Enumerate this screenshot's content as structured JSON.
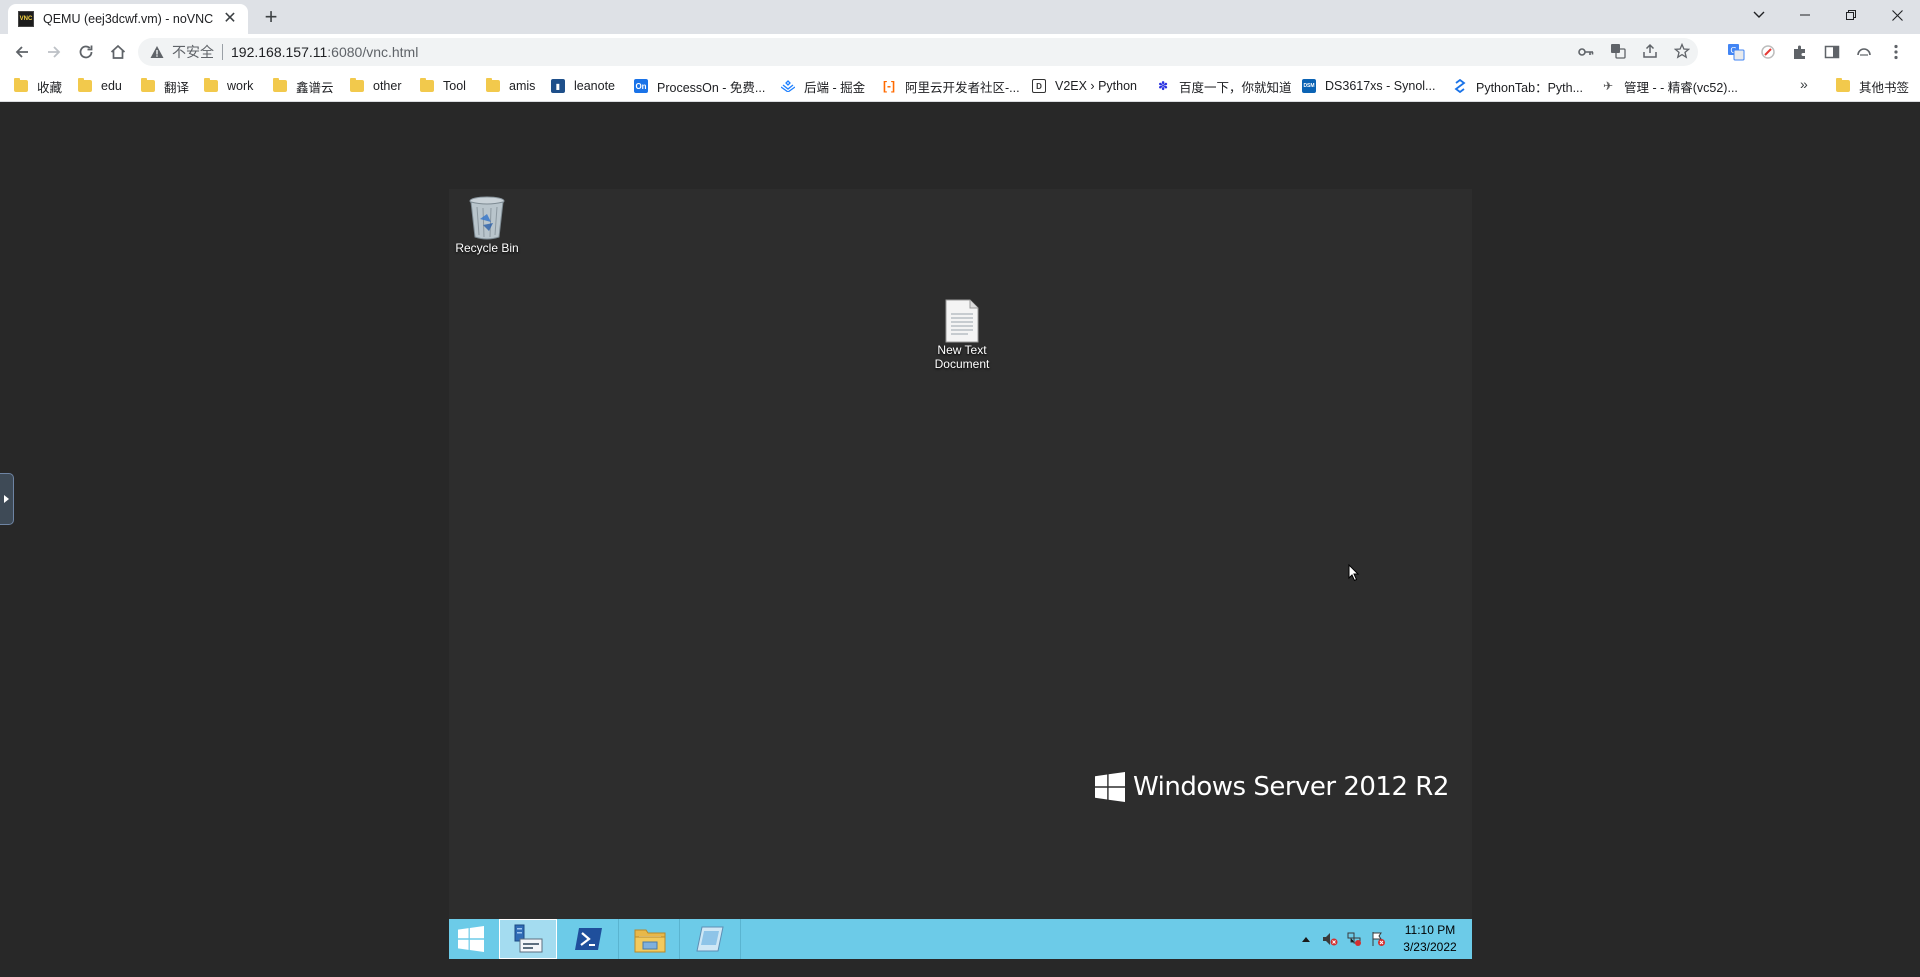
{
  "browser": {
    "tab": {
      "title": "QEMU (eej3dcwf.vm) - noVNC",
      "favicon_text": "VNC"
    },
    "window_controls": [
      "chevron-down-icon",
      "minimize-icon",
      "restore-icon",
      "close-icon"
    ],
    "toolbar": {
      "security_label": "不安全",
      "url_host": "192.168.157.11",
      "url_path": ":6080/vnc.html"
    },
    "bookmarks": [
      {
        "label": "收藏",
        "type": "folder"
      },
      {
        "label": "edu",
        "type": "folder"
      },
      {
        "label": "翻译",
        "type": "folder"
      },
      {
        "label": "work",
        "type": "folder"
      },
      {
        "label": "鑫谱云",
        "type": "folder"
      },
      {
        "label": "other",
        "type": "folder"
      },
      {
        "label": "Tool",
        "type": "folder"
      },
      {
        "label": "amis",
        "type": "folder"
      },
      {
        "label": "leanote",
        "type": "site",
        "color": "#1e4f8a"
      },
      {
        "label": "ProcessOn - 免费...",
        "type": "site",
        "color": "#1a73e8",
        "icon_text": "On"
      },
      {
        "label": "后端 - 掘金",
        "type": "site",
        "color": "#1e80ff"
      },
      {
        "label": "阿里云开发者社区-...",
        "type": "site",
        "color": "#ff6a00"
      },
      {
        "label": "V2EX › Python",
        "type": "site",
        "color": "#333333"
      },
      {
        "label": "百度一下，你就知道",
        "type": "site",
        "color": "#2932e1"
      },
      {
        "label": "DS3617xs - Synol...",
        "type": "site",
        "color": "#0b63b4",
        "icon_text": "DSM"
      },
      {
        "label": "PythonTab：Pyth...",
        "type": "site",
        "color": "#1a73e8"
      },
      {
        "label": "管理 - - 精睿(vc52)...",
        "type": "site",
        "color": "#555555"
      }
    ],
    "other_bookmarks": "其他书签"
  },
  "desktop": {
    "icons": [
      {
        "label": "Recycle Bin"
      },
      {
        "label": "New Text\nDocument"
      }
    ],
    "watermark": "Windows Server 2012 R2",
    "colors": {
      "background": "#2d2d2d",
      "taskbar": "#6ccbe8"
    },
    "taskbar": {
      "time": "11:10 PM",
      "date": "3/23/2022",
      "apps": [
        "start-button",
        "server-manager",
        "powershell",
        "file-explorer",
        "app"
      ]
    }
  }
}
